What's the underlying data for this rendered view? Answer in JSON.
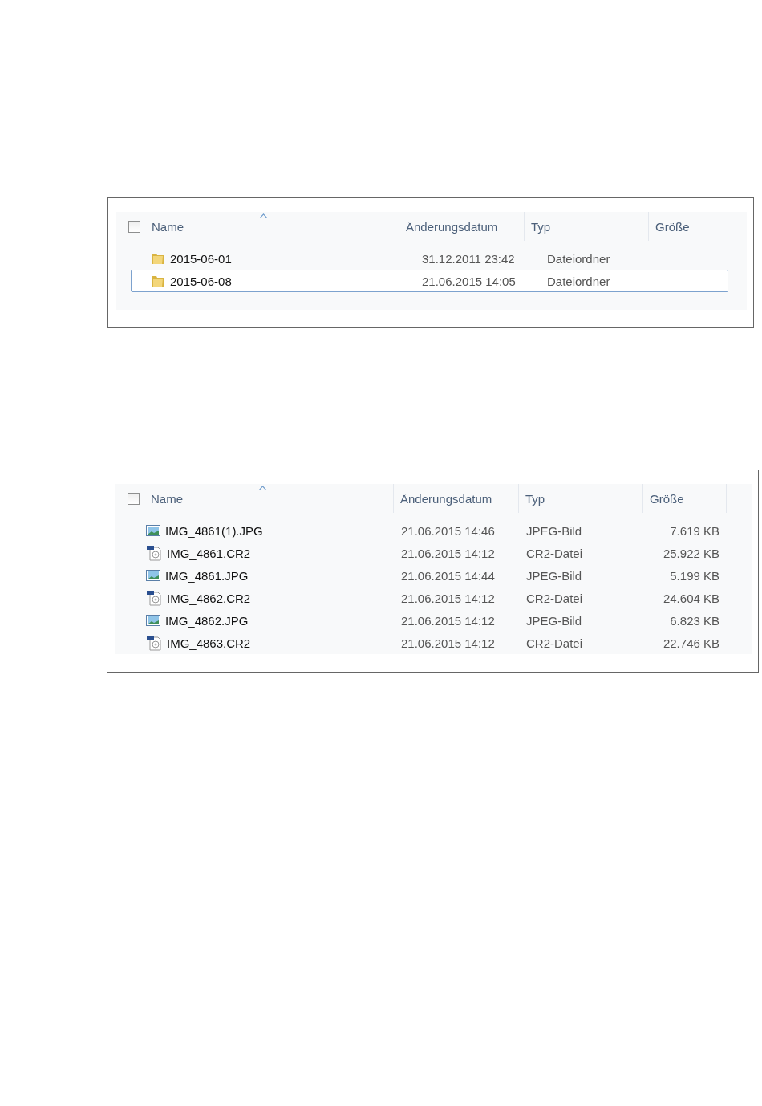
{
  "panels": [
    {
      "select_all": {
        "checked": false
      },
      "columns": [
        {
          "label": "Name",
          "sorted": true
        },
        {
          "label": "Änderungsdatum",
          "sorted": false
        },
        {
          "label": "Typ",
          "sorted": false
        },
        {
          "label": "Größe",
          "sorted": false
        }
      ],
      "rows": [
        {
          "kind": "folder",
          "name": "2015-06-01",
          "date": "31.12.2011 23:42",
          "type": "Dateiordner",
          "selected": false
        },
        {
          "kind": "folder",
          "name": "2015-06-08",
          "date": "21.06.2015 14:05",
          "type": "Dateiordner",
          "selected": true
        }
      ]
    },
    {
      "select_all": {
        "checked": false
      },
      "columns": [
        {
          "label": "Name",
          "sorted": true
        },
        {
          "label": "Änderungsdatum",
          "sorted": false
        },
        {
          "label": "Typ",
          "sorted": false
        },
        {
          "label": "Größe",
          "sorted": false
        }
      ],
      "rows": [
        {
          "kind": "image",
          "name": "IMG_4861(1).JPG",
          "date": "21.06.2015 14:46",
          "type": "JPEG-Bild",
          "size": "7.619 KB",
          "selected": false
        },
        {
          "kind": "raw",
          "name": "IMG_4861.CR2",
          "date": "21.06.2015 14:12",
          "type": "CR2-Datei",
          "size": "25.922 KB",
          "selected": false
        },
        {
          "kind": "image",
          "name": "IMG_4861.JPG",
          "date": "21.06.2015 14:44",
          "type": "JPEG-Bild",
          "size": "5.199 KB",
          "selected": false
        },
        {
          "kind": "raw",
          "name": "IMG_4862.CR2",
          "date": "21.06.2015 14:12",
          "type": "CR2-Datei",
          "size": "24.604 KB",
          "selected": false
        },
        {
          "kind": "image",
          "name": "IMG_4862.JPG",
          "date": "21.06.2015 14:12",
          "type": "JPEG-Bild",
          "size": "6.823 KB",
          "selected": false
        },
        {
          "kind": "raw",
          "name": "IMG_4863.CR2",
          "date": "21.06.2015 14:12",
          "type": "CR2-Datei",
          "size": "22.746 KB",
          "selected": false
        }
      ]
    }
  ]
}
